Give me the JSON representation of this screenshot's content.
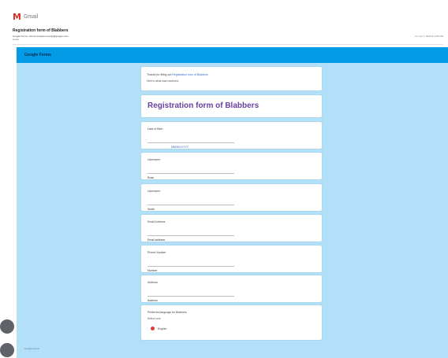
{
  "header": {
    "app_name": "Gmail",
    "subject": "Registration form of Blabbers",
    "sender": "Google Forms <forms-receipts-noreply@google.com>",
    "recipient": "to me",
    "date": "Fri, Apr 7, 2023 at 3:45 PM"
  },
  "form": {
    "brand": "Google Forms",
    "thanks_prefix": "Thanks for filling out ",
    "thanks_link": "Registration form of Blabbers",
    "thanks_sub": "Here's what was received.",
    "title": "Registration form of Blabbers",
    "questions": [
      {
        "label": "Date of Birth",
        "value": "MM/DD/YYYY"
      },
      {
        "label": "Username",
        "value": "Rose"
      },
      {
        "label": "Username",
        "value": "Smith"
      },
      {
        "label": "Email Address",
        "value": "Email address"
      },
      {
        "label": "Phone Number",
        "value": "Number"
      },
      {
        "label": "Address",
        "value": "Address"
      }
    ],
    "last_question": {
      "label": "Preferred language for Blabbers",
      "sub": "Select one",
      "option": "English"
    },
    "footer": "Google Forms"
  }
}
